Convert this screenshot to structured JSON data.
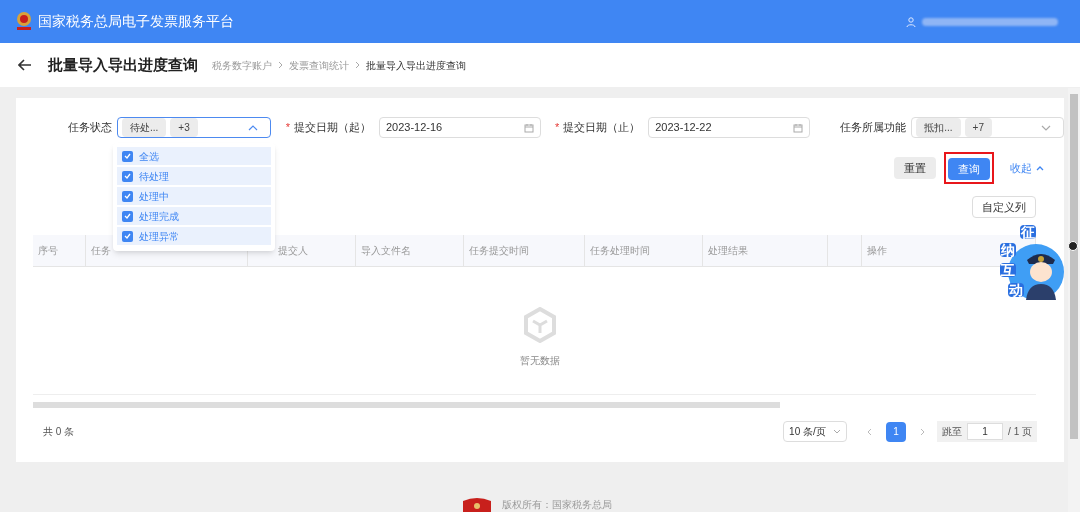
{
  "header": {
    "title": "国家税务总局电子发票服务平台"
  },
  "page": {
    "title": "批量导入导出进度查询",
    "breadcrumbs": [
      "税务数字账户",
      "发票查询统计",
      "批量导入导出进度查询"
    ]
  },
  "filters": {
    "status": {
      "label": "任务状态",
      "tags": [
        "待处...",
        "+3"
      ],
      "expanded": true
    },
    "date_start": {
      "label": "提交日期（起）",
      "required_mark": "*",
      "value": "2023-12-16"
    },
    "date_end": {
      "label": "提交日期（止）",
      "required_mark": "*",
      "value": "2023-12-22"
    },
    "function": {
      "label": "任务所属功能",
      "tags": [
        "抵扣...",
        "+7"
      ],
      "expanded": false
    }
  },
  "status_options": [
    {
      "label": "全选",
      "checked": true
    },
    {
      "label": "待处理",
      "checked": true
    },
    {
      "label": "处理中",
      "checked": true
    },
    {
      "label": "处理完成",
      "checked": true
    },
    {
      "label": "处理异常",
      "checked": true
    }
  ],
  "actions": {
    "reset": "重置",
    "search": "查询",
    "collapse": "收起",
    "customize": "自定义列"
  },
  "table": {
    "columns": [
      "序号",
      "任务",
      "提交人",
      "导入文件名",
      "任务提交时间",
      "任务处理时间",
      "处理结果",
      "",
      "操作"
    ],
    "empty_text": "暂无数据"
  },
  "pagination": {
    "total": "共 0 条",
    "page_size": "10 条/页",
    "pages": [
      {
        "label": "1",
        "selected": true
      }
    ],
    "jump_label": "跳至",
    "jump_value": "1",
    "page_count": "/ 1 页"
  },
  "assistant": {
    "chars": [
      "征",
      "纳",
      "互",
      "动"
    ]
  },
  "footer": {
    "text": "版权所有：国家税务总局"
  }
}
